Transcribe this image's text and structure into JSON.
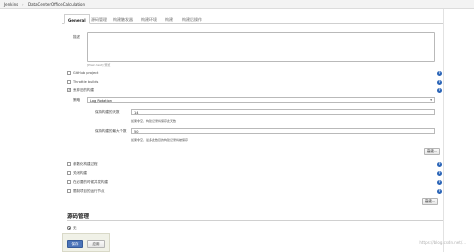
{
  "breadcrumb": {
    "items": [
      "Jenkins",
      "DataCenterOfficeCalculation"
    ],
    "separator": "›"
  },
  "tabs": [
    {
      "label": "General",
      "active": true
    },
    {
      "label": "源码管理",
      "active": false
    },
    {
      "label": "构建触发器",
      "active": false
    },
    {
      "label": "构建环境",
      "active": false
    },
    {
      "label": "构建",
      "active": false
    },
    {
      "label": "构建后操作",
      "active": false
    }
  ],
  "general": {
    "description_label": "描述",
    "description_value": "",
    "preview_link": "[Plain text] 预览",
    "github_project": "GitHub project",
    "throttle_builds": "Throttle builds",
    "discard_old_builds": "丢弃旧的构建",
    "strategy_label": "策略",
    "strategy_value": "Log Rotation",
    "days_label": "保持构建的天数",
    "days_value": "14",
    "days_hint": "如果非空，构建记录将保存此天数",
    "max_label": "保持构建的最大个数",
    "max_value": "50",
    "max_hint": "如果非空，最多此数目的构建记录将被保存",
    "advanced_button": "高级...",
    "parameterized": "参数化构建过程",
    "disable_build": "关闭构建",
    "concurrent": "在必要的时候并发构建",
    "quiet_period": "限制项目的运行节点",
    "advanced_button_2": "高级..."
  },
  "scm": {
    "title": "源码管理",
    "none_option": "无"
  },
  "footer": {
    "save": "保存",
    "apply": "应用"
  },
  "watermark": "https://blog.csdn.net/..."
}
